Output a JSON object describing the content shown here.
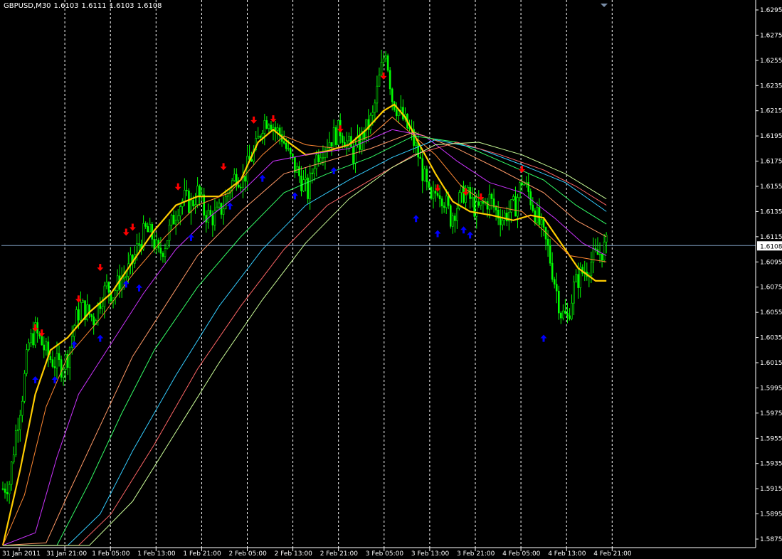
{
  "header": {
    "symbol": "GBPUSD,M30",
    "open": "1.6103",
    "high": "1.6111",
    "low": "1.6103",
    "close": "1.6108"
  },
  "colors": {
    "background": "#000000",
    "grid": "#ffffff",
    "candle": "#00ff00",
    "bid_line": "#7f9fbf",
    "arrow_down": "#ff0000",
    "arrow_up": "#0000ff",
    "ma_main": "#ffcc00"
  },
  "chart_data": {
    "type": "line",
    "instrument": "GBPUSD,M30",
    "ylim": [
      1.587,
      1.63
    ],
    "price_ticks": [
      "1.6295",
      "1.6275",
      "1.6255",
      "1.6235",
      "1.6215",
      "1.6195",
      "1.6175",
      "1.6155",
      "1.6135",
      "1.6115",
      "1.6095",
      "1.6075",
      "1.6055",
      "1.6035",
      "1.6015",
      "1.5995",
      "1.5975",
      "1.5955",
      "1.5935",
      "1.5915",
      "1.5895",
      "1.5875"
    ],
    "time_ticks": [
      "31 Jan 2011",
      "31 Jan 21:00",
      "1 Feb 05:00",
      "1 Feb 13:00",
      "1 Feb 21:00",
      "2 Feb 05:00",
      "2 Feb 13:00",
      "2 Feb 21:00",
      "3 Feb 05:00",
      "3 Feb 13:00",
      "3 Feb 21:00",
      "4 Feb 05:00",
      "4 Feb 13:00",
      "4 Feb 21:00"
    ],
    "bid": "1.6108",
    "price_path": [
      [
        0,
        1.5915
      ],
      [
        3,
        1.592
      ],
      [
        6,
        1.596
      ],
      [
        9,
        1.599
      ],
      [
        12,
        1.603
      ],
      [
        15,
        1.604
      ],
      [
        18,
        1.603
      ],
      [
        21,
        1.602
      ],
      [
        24,
        1.6015
      ],
      [
        27,
        1.6012
      ],
      [
        30,
        1.602
      ],
      [
        33,
        1.6045
      ],
      [
        36,
        1.606
      ],
      [
        39,
        1.6055
      ],
      [
        42,
        1.605
      ],
      [
        45,
        1.6065
      ],
      [
        48,
        1.6075
      ],
      [
        51,
        1.607
      ],
      [
        54,
        1.608
      ],
      [
        57,
        1.6085
      ],
      [
        60,
        1.6095
      ],
      [
        63,
        1.611
      ],
      [
        66,
        1.612
      ],
      [
        69,
        1.6115
      ],
      [
        72,
        1.61
      ],
      [
        75,
        1.611
      ],
      [
        78,
        1.6125
      ],
      [
        81,
        1.614
      ],
      [
        84,
        1.6145
      ],
      [
        87,
        1.614
      ],
      [
        90,
        1.615
      ],
      [
        93,
        1.6135
      ],
      [
        96,
        1.613
      ],
      [
        99,
        1.6132
      ],
      [
        102,
        1.614
      ],
      [
        105,
        1.6155
      ],
      [
        108,
        1.6165
      ],
      [
        111,
        1.616
      ],
      [
        114,
        1.6175
      ],
      [
        117,
        1.6185
      ],
      [
        120,
        1.6205
      ],
      [
        123,
        1.621
      ],
      [
        126,
        1.62
      ],
      [
        129,
        1.6195
      ],
      [
        132,
        1.618
      ],
      [
        135,
        1.617
      ],
      [
        138,
        1.616
      ],
      [
        141,
        1.615
      ],
      [
        144,
        1.6175
      ],
      [
        147,
        1.6185
      ],
      [
        150,
        1.619
      ],
      [
        153,
        1.6195
      ],
      [
        156,
        1.62
      ],
      [
        159,
        1.619
      ],
      [
        162,
        1.618
      ],
      [
        165,
        1.619
      ],
      [
        168,
        1.62
      ],
      [
        171,
        1.621
      ],
      [
        174,
        1.624
      ],
      [
        177,
        1.6265
      ],
      [
        180,
        1.6225
      ],
      [
        183,
        1.6215
      ],
      [
        186,
        1.6205
      ],
      [
        189,
        1.6195
      ],
      [
        192,
        1.618
      ],
      [
        195,
        1.616
      ],
      [
        198,
        1.614
      ],
      [
        201,
        1.6155
      ],
      [
        204,
        1.6145
      ],
      [
        207,
        1.613
      ],
      [
        210,
        1.614
      ],
      [
        213,
        1.615
      ],
      [
        216,
        1.6145
      ],
      [
        219,
        1.6135
      ],
      [
        222,
        1.614
      ],
      [
        225,
        1.6145
      ],
      [
        228,
        1.6135
      ],
      [
        231,
        1.613
      ],
      [
        234,
        1.6135
      ],
      [
        237,
        1.614
      ],
      [
        240,
        1.616
      ],
      [
        243,
        1.615
      ],
      [
        246,
        1.6135
      ],
      [
        249,
        1.612
      ],
      [
        252,
        1.6105
      ],
      [
        255,
        1.608
      ],
      [
        258,
        1.6055
      ],
      [
        261,
        1.605
      ],
      [
        264,
        1.6075
      ],
      [
        267,
        1.6085
      ],
      [
        270,
        1.609
      ],
      [
        273,
        1.6098
      ],
      [
        276,
        1.6102
      ],
      [
        279,
        1.6108
      ]
    ],
    "series": [
      {
        "color": "#ffcc00",
        "width": 2.2,
        "path": [
          [
            0,
            1.587
          ],
          [
            8,
            1.593
          ],
          [
            15,
            1.599
          ],
          [
            22,
            1.6025
          ],
          [
            30,
            1.6035
          ],
          [
            40,
            1.6055
          ],
          [
            50,
            1.607
          ],
          [
            60,
            1.6095
          ],
          [
            70,
            1.612
          ],
          [
            80,
            1.614
          ],
          [
            90,
            1.6147
          ],
          [
            100,
            1.6147
          ],
          [
            110,
            1.616
          ],
          [
            118,
            1.619
          ],
          [
            125,
            1.62
          ],
          [
            132,
            1.619
          ],
          [
            140,
            1.618
          ],
          [
            150,
            1.6183
          ],
          [
            160,
            1.6188
          ],
          [
            168,
            1.62
          ],
          [
            176,
            1.6215
          ],
          [
            181,
            1.622
          ],
          [
            186,
            1.621
          ],
          [
            192,
            1.619
          ],
          [
            200,
            1.6165
          ],
          [
            208,
            1.6143
          ],
          [
            216,
            1.6135
          ],
          [
            226,
            1.6132
          ],
          [
            236,
            1.6128
          ],
          [
            244,
            1.6132
          ],
          [
            250,
            1.613
          ],
          [
            258,
            1.611
          ],
          [
            266,
            1.609
          ],
          [
            274,
            1.608
          ],
          [
            279,
            1.608
          ]
        ]
      },
      {
        "color": "#ff8833",
        "width": 1,
        "path": [
          [
            0,
            1.587
          ],
          [
            10,
            1.591
          ],
          [
            20,
            1.598
          ],
          [
            30,
            1.602
          ],
          [
            45,
            1.605
          ],
          [
            60,
            1.6085
          ],
          [
            75,
            1.6115
          ],
          [
            90,
            1.614
          ],
          [
            105,
            1.615
          ],
          [
            120,
            1.618
          ],
          [
            130,
            1.6195
          ],
          [
            140,
            1.6188
          ],
          [
            155,
            1.6185
          ],
          [
            170,
            1.6195
          ],
          [
            180,
            1.621
          ],
          [
            190,
            1.6195
          ],
          [
            200,
            1.618
          ],
          [
            212,
            1.6155
          ],
          [
            225,
            1.614
          ],
          [
            240,
            1.6135
          ],
          [
            250,
            1.612
          ],
          [
            262,
            1.61
          ],
          [
            279,
            1.6095
          ]
        ]
      },
      {
        "color": "#cc33ff",
        "width": 1,
        "path": [
          [
            0,
            1.587
          ],
          [
            15,
            1.588
          ],
          [
            25,
            1.594
          ],
          [
            35,
            1.599
          ],
          [
            50,
            1.603
          ],
          [
            65,
            1.607
          ],
          [
            80,
            1.6105
          ],
          [
            95,
            1.613
          ],
          [
            110,
            1.615
          ],
          [
            125,
            1.6175
          ],
          [
            140,
            1.618
          ],
          [
            160,
            1.6185
          ],
          [
            180,
            1.62
          ],
          [
            195,
            1.6195
          ],
          [
            210,
            1.6175
          ],
          [
            225,
            1.6158
          ],
          [
            240,
            1.615
          ],
          [
            255,
            1.613
          ],
          [
            268,
            1.611
          ],
          [
            279,
            1.61
          ]
        ]
      },
      {
        "color": "#ff9966",
        "width": 1,
        "path": [
          [
            0,
            1.587
          ],
          [
            20,
            1.5872
          ],
          [
            30,
            1.591
          ],
          [
            45,
            1.5965
          ],
          [
            60,
            1.602
          ],
          [
            75,
            1.606
          ],
          [
            90,
            1.61
          ],
          [
            110,
            1.6135
          ],
          [
            130,
            1.6165
          ],
          [
            150,
            1.6175
          ],
          [
            170,
            1.6185
          ],
          [
            190,
            1.6198
          ],
          [
            210,
            1.6185
          ],
          [
            230,
            1.6168
          ],
          [
            250,
            1.615
          ],
          [
            265,
            1.6128
          ],
          [
            279,
            1.6115
          ]
        ]
      },
      {
        "color": "#33ff66",
        "width": 1,
        "path": [
          [
            0,
            1.587
          ],
          [
            25,
            1.587
          ],
          [
            40,
            1.592
          ],
          [
            55,
            1.5975
          ],
          [
            70,
            1.6025
          ],
          [
            90,
            1.6075
          ],
          [
            110,
            1.6115
          ],
          [
            130,
            1.615
          ],
          [
            150,
            1.6165
          ],
          [
            170,
            1.6178
          ],
          [
            190,
            1.6195
          ],
          [
            210,
            1.619
          ],
          [
            230,
            1.6175
          ],
          [
            250,
            1.616
          ],
          [
            265,
            1.614
          ],
          [
            279,
            1.6125
          ]
        ]
      },
      {
        "color": "#33ccff",
        "width": 1,
        "path": [
          [
            0,
            1.587
          ],
          [
            30,
            1.587
          ],
          [
            45,
            1.5895
          ],
          [
            60,
            1.5945
          ],
          [
            80,
            1.6005
          ],
          [
            100,
            1.606
          ],
          [
            120,
            1.6105
          ],
          [
            140,
            1.614
          ],
          [
            160,
            1.616
          ],
          [
            180,
            1.6178
          ],
          [
            200,
            1.6192
          ],
          [
            220,
            1.6185
          ],
          [
            240,
            1.6172
          ],
          [
            260,
            1.6158
          ],
          [
            279,
            1.6135
          ]
        ]
      },
      {
        "color": "#ff6666",
        "width": 1,
        "path": [
          [
            0,
            1.587
          ],
          [
            35,
            1.587
          ],
          [
            50,
            1.5895
          ],
          [
            70,
            1.595
          ],
          [
            90,
            1.601
          ],
          [
            110,
            1.606
          ],
          [
            130,
            1.6105
          ],
          [
            150,
            1.614
          ],
          [
            170,
            1.616
          ],
          [
            190,
            1.618
          ],
          [
            210,
            1.619
          ],
          [
            230,
            1.618
          ],
          [
            250,
            1.6168
          ],
          [
            265,
            1.6155
          ],
          [
            279,
            1.614
          ]
        ]
      },
      {
        "color": "#ccff99",
        "width": 1,
        "path": [
          [
            0,
            1.587
          ],
          [
            40,
            1.587
          ],
          [
            60,
            1.5905
          ],
          [
            80,
            1.596
          ],
          [
            100,
            1.6015
          ],
          [
            120,
            1.6065
          ],
          [
            140,
            1.611
          ],
          [
            160,
            1.6145
          ],
          [
            180,
            1.617
          ],
          [
            200,
            1.6188
          ],
          [
            220,
            1.619
          ],
          [
            240,
            1.618
          ],
          [
            260,
            1.6165
          ],
          [
            279,
            1.6145
          ]
        ]
      }
    ],
    "arrows_down": [
      [
        15,
        1.6042
      ],
      [
        18,
        1.6038
      ],
      [
        35,
        1.6065
      ],
      [
        45,
        1.609
      ],
      [
        57,
        1.6118
      ],
      [
        60,
        1.6122
      ],
      [
        81,
        1.6154
      ],
      [
        102,
        1.617
      ],
      [
        116,
        1.6207
      ],
      [
        125,
        1.6208
      ],
      [
        156,
        1.62
      ],
      [
        176,
        1.6242
      ],
      [
        201,
        1.6153
      ],
      [
        214,
        1.615
      ],
      [
        221,
        1.6146
      ],
      [
        240,
        1.6168
      ]
    ],
    "arrows_up": [
      [
        15,
        1.6002
      ],
      [
        24,
        1.6002
      ],
      [
        33,
        1.603
      ],
      [
        45,
        1.6035
      ],
      [
        57,
        1.6078
      ],
      [
        63,
        1.6075
      ],
      [
        87,
        1.6115
      ],
      [
        105,
        1.614
      ],
      [
        120,
        1.6162
      ],
      [
        135,
        1.6148
      ],
      [
        153,
        1.6168
      ],
      [
        191,
        1.613
      ],
      [
        201,
        1.6118
      ],
      [
        213,
        1.6121
      ],
      [
        216,
        1.6117
      ],
      [
        250,
        1.6035
      ]
    ]
  }
}
